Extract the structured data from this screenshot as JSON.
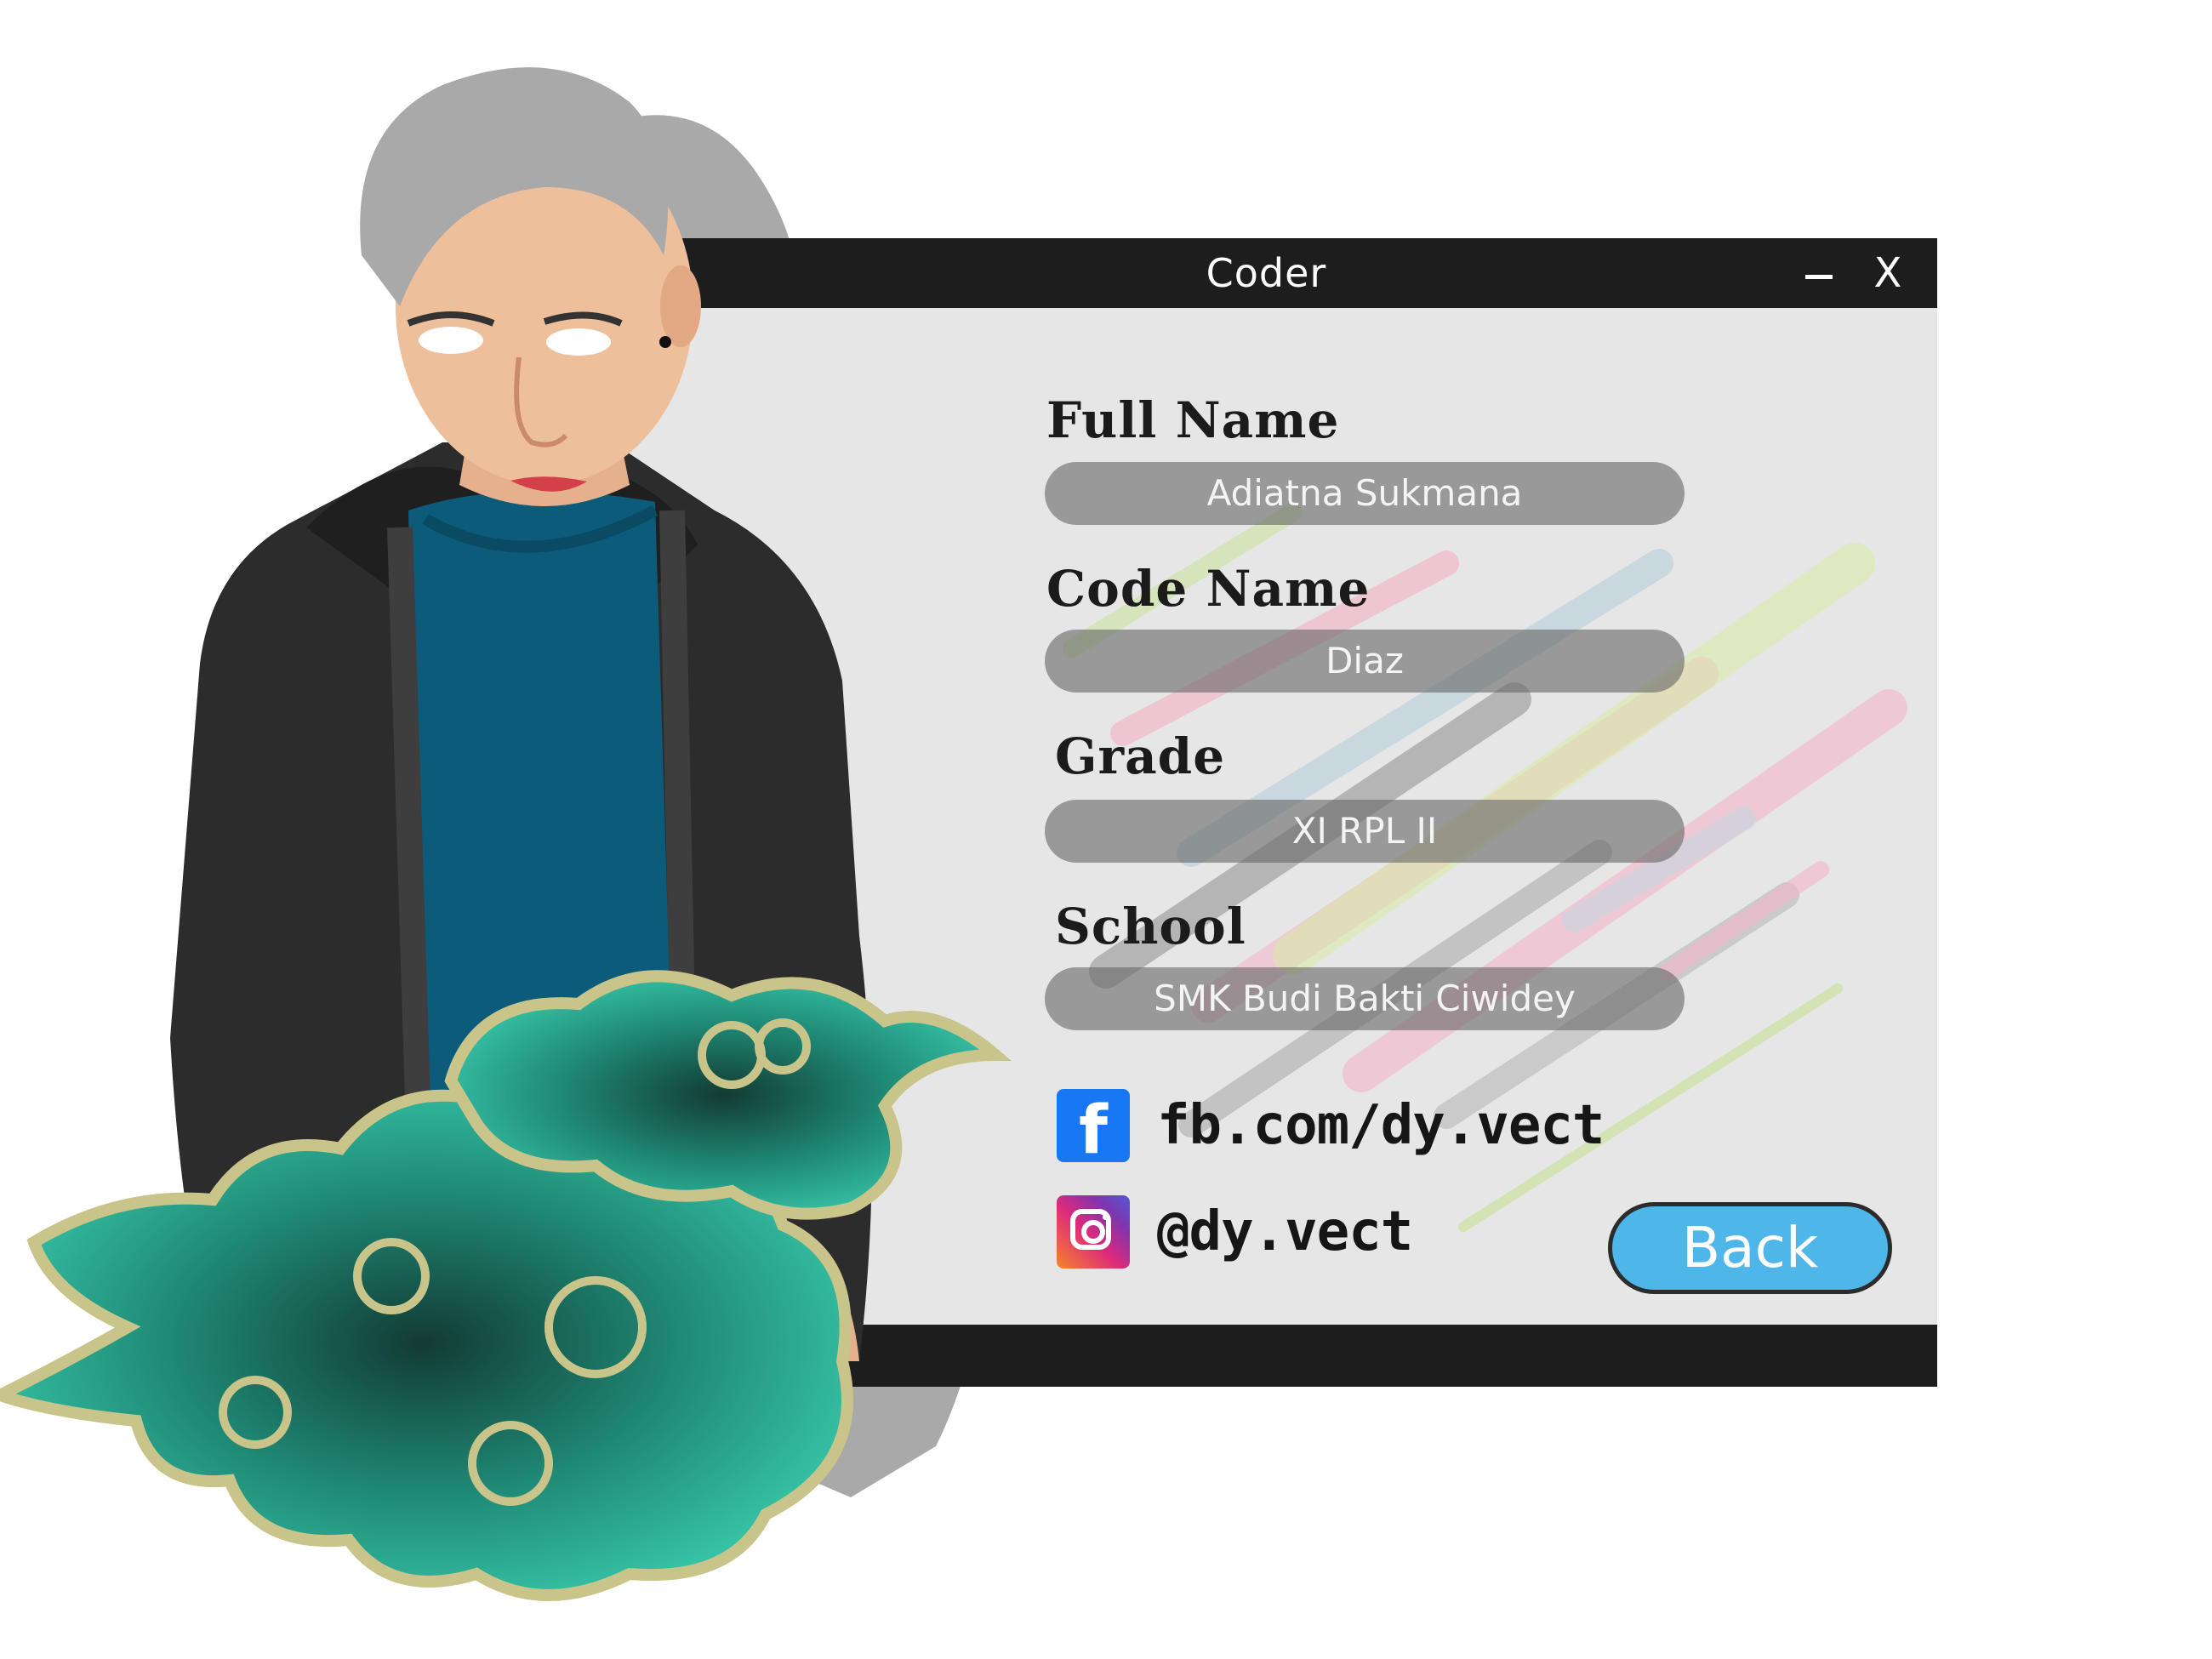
{
  "window": {
    "title": "Coder",
    "minimize_icon": "minimize-icon",
    "close_label": "X"
  },
  "profile": {
    "full_name_label": "Full Name",
    "full_name_value": "Adiatna Sukmana",
    "code_name_label": "Code Name",
    "code_name_value": "Diaz",
    "grade_label": "Grade",
    "grade_value": "XI RPL II",
    "school_label": "School",
    "school_value": "SMK Budi Bakti Ciwidey"
  },
  "social": {
    "facebook_icon": "facebook-icon",
    "facebook_glyph": "f",
    "facebook": "fb.com/dy.vect",
    "instagram_icon": "instagram-icon",
    "instagram": "@dy.vect"
  },
  "actions": {
    "back_label": "Back"
  },
  "colors": {
    "titlebar": "#1d1d1d",
    "window_bg": "#e6e6e6",
    "back_button": "#4fb6ea",
    "facebook": "#1877f2"
  }
}
